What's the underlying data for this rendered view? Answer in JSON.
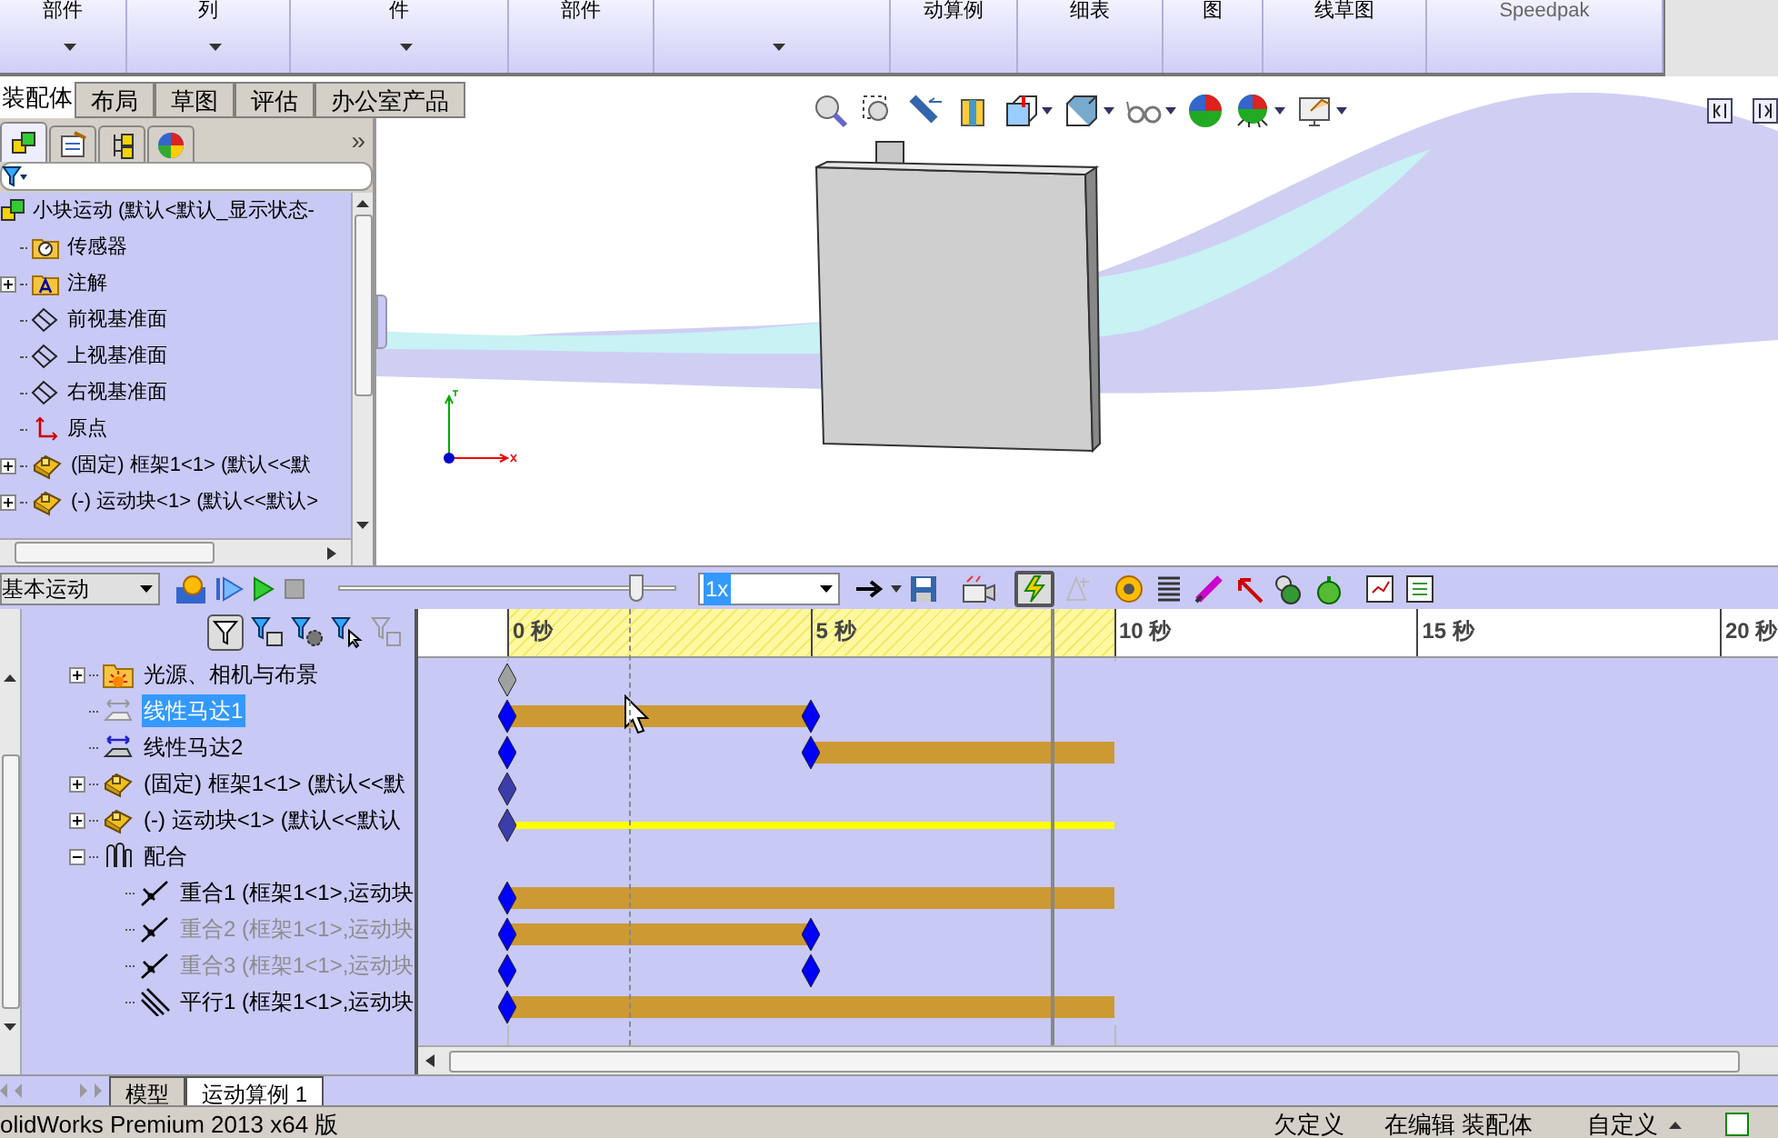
{
  "ribbon": {
    "items": [
      {
        "text": "部件",
        "dropdown": true
      },
      {
        "text": "列",
        "dropdown": true
      },
      {
        "text": "件",
        "dropdown": true
      },
      {
        "text": "部件",
        "dropdown": false
      },
      {
        "dropdown": true
      },
      {
        "text": "动算例",
        "dropdown": false
      },
      {
        "text": "细表",
        "dropdown": false
      },
      {
        "text": "图",
        "dropdown": false
      },
      {
        "text": "线草图",
        "dropdown": false
      },
      {
        "text": "Speedpak",
        "dropdown": false
      }
    ]
  },
  "command_tabs": [
    {
      "label": "装配体",
      "selected": true
    },
    {
      "label": "布局",
      "selected": false
    },
    {
      "label": "草图",
      "selected": false
    },
    {
      "label": "评估",
      "selected": false
    },
    {
      "label": "办公室产品",
      "selected": false
    }
  ],
  "feature_tree": {
    "tabs": [
      {
        "kind": "feature",
        "selected": true
      },
      {
        "kind": "property",
        "selected": false
      },
      {
        "kind": "config",
        "selected": false
      },
      {
        "kind": "display",
        "selected": false
      }
    ],
    "more": "»",
    "items": [
      {
        "label": "小块运动 (默认<默认_显示状态-",
        "kind": "assembly",
        "expandable": false,
        "children": [
          {
            "label": "传感器",
            "kind": "sensor",
            "expandable": false
          },
          {
            "label": "注解",
            "kind": "annotation",
            "expandable": true,
            "expanded": false
          },
          {
            "label": "前视基准面",
            "kind": "plane",
            "expandable": false
          },
          {
            "label": "上视基准面",
            "kind": "plane",
            "expandable": false
          },
          {
            "label": "右视基准面",
            "kind": "plane",
            "expandable": false
          },
          {
            "label": "原点",
            "kind": "origin",
            "expandable": false
          },
          {
            "label": "(固定) 框架1<1> (默认<<默",
            "kind": "part",
            "expandable": true,
            "expanded": false
          },
          {
            "label": "(-) 运动块<1> (默认<<默认>",
            "kind": "part",
            "expandable": true,
            "expanded": false
          }
        ]
      }
    ]
  },
  "motion_toolbar": {
    "study_type": "基本运动",
    "slider": {
      "level": 0.88
    },
    "speed": "1x",
    "autokey": {
      "on": true
    }
  },
  "timeline": {
    "filter": {
      "on": true
    },
    "ticks": [
      "0 秒",
      "5 秒",
      "10 秒",
      "15 秒",
      "20 秒"
    ],
    "calculated_range": {
      "level": 0.5
    },
    "time_bar": {
      "level": 0.45
    },
    "hover_line": {
      "level": 0.1
    },
    "rows": [
      {
        "label": "光源、相机与布景",
        "kind": "lights",
        "expandable": true,
        "expanded": false,
        "selected": false,
        "disabled": false,
        "keys": [
          {
            "level": 0,
            "kind": "inactive"
          }
        ]
      },
      {
        "label": "线性马达1",
        "kind": "motor-off",
        "expandable": false,
        "selected": true,
        "disabled": false,
        "keys": [
          {
            "level": 0,
            "kind": "normal"
          },
          {
            "level": 0.25,
            "kind": "normal"
          }
        ],
        "bar": {
          "kind": "motion",
          "level": 0.25,
          "after_gap": false
        }
      },
      {
        "label": "线性马达2",
        "kind": "motor",
        "expandable": false,
        "selected": false,
        "disabled": false,
        "keys": [
          {
            "level": 0,
            "kind": "normal"
          },
          {
            "level": 0.25,
            "kind": "normal"
          }
        ],
        "bar": {
          "kind": "motion",
          "level": 0.5,
          "after_gap": true
        }
      },
      {
        "label": "(固定) 框架1<1> (默认<<默",
        "kind": "part",
        "expandable": true,
        "expanded": false,
        "selected": false,
        "disabled": false,
        "keys": [
          {
            "level": 0,
            "kind": "component"
          }
        ]
      },
      {
        "label": "(-) 运动块<1> (默认<<默认",
        "kind": "part",
        "expandable": true,
        "expanded": false,
        "selected": false,
        "disabled": false,
        "keys": [
          {
            "level": 0,
            "kind": "component"
          }
        ],
        "bar": {
          "kind": "active",
          "level": 0.5,
          "after_gap": false
        }
      },
      {
        "label": "配合",
        "kind": "mates",
        "expandable": true,
        "expanded": true,
        "selected": false,
        "disabled": false,
        "keys": [],
        "children": [
          {
            "label": "重合1 (框架1<1>,运动块",
            "kind": "coincident",
            "expandable": false,
            "selected": false,
            "disabled": false,
            "keys": [
              {
                "level": 0,
                "kind": "normal"
              }
            ],
            "bar": {
              "kind": "motion",
              "level": 0.5,
              "after_gap": false
            }
          },
          {
            "label": "重合2 (框架1<1>,运动块",
            "kind": "coincident",
            "expandable": false,
            "selected": false,
            "disabled": true,
            "keys": [
              {
                "level": 0,
                "kind": "normal"
              },
              {
                "level": 0.25,
                "kind": "normal"
              }
            ],
            "bar": {
              "kind": "motion",
              "level": 0.25,
              "after_gap": false
            }
          },
          {
            "label": "重合3 (框架1<1>,运动块",
            "kind": "coincident",
            "expandable": false,
            "selected": false,
            "disabled": true,
            "keys": [
              {
                "level": 0,
                "kind": "normal"
              },
              {
                "level": 0.25,
                "kind": "normal"
              }
            ]
          },
          {
            "label": "平行1 (框架1<1>,运动块",
            "kind": "parallel",
            "expandable": false,
            "selected": false,
            "disabled": false,
            "keys": [
              {
                "level": 0,
                "kind": "normal"
              }
            ],
            "bar": {
              "kind": "motion",
              "level": 0.5,
              "after_gap": false
            }
          }
        ]
      }
    ]
  },
  "bottom_tabs": [
    {
      "label": "模型",
      "selected": false
    },
    {
      "label": "运动算例 1",
      "selected": true
    }
  ],
  "status_bar": {
    "product": "olidWorks Premium 2013 x64 版",
    "state": "欠定义",
    "mode": "在编辑 装配体",
    "units": "自定义"
  }
}
